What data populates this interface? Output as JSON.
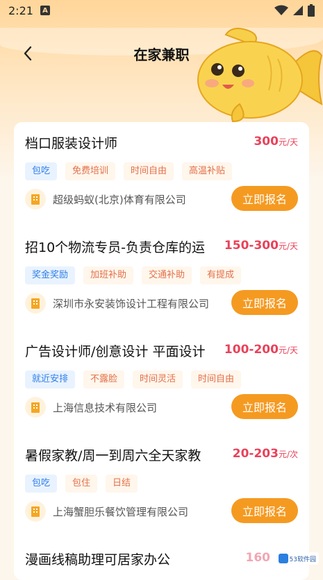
{
  "status_bar": {
    "time": "2:21",
    "indicator": "A"
  },
  "header": {
    "title": "在家兼职"
  },
  "jobs": [
    {
      "title": "档口服装设计师",
      "salary": "300",
      "unit": "元/天",
      "tags": [
        {
          "label": "包吃",
          "style": "blue"
        },
        {
          "label": "免费培训",
          "style": "orange"
        },
        {
          "label": "时间自由",
          "style": "orange"
        },
        {
          "label": "高温补贴",
          "style": "orange"
        }
      ],
      "company": "超级蚂蚁(北京)体育有限公司",
      "apply": "立即报名"
    },
    {
      "title": "招10个物流专员-负责仓库的运",
      "salary": "150-300",
      "unit": "元/天",
      "tags": [
        {
          "label": "奖金奖励",
          "style": "blue"
        },
        {
          "label": "加班补助",
          "style": "orange"
        },
        {
          "label": "交通补助",
          "style": "orange"
        },
        {
          "label": "有提成",
          "style": "orange"
        }
      ],
      "company": "深圳市永安装饰设计工程有限公司",
      "apply": "立即报名"
    },
    {
      "title": "广告设计师/创意设计 平面设计",
      "salary": "100-200",
      "unit": "元/天",
      "tags": [
        {
          "label": "就近安排",
          "style": "blue"
        },
        {
          "label": "不露脸",
          "style": "orange"
        },
        {
          "label": "时间灵活",
          "style": "orange"
        },
        {
          "label": "时间自由",
          "style": "orange"
        }
      ],
      "company": "上海信息技术有限公司",
      "apply": "立即报名"
    },
    {
      "title": "暑假家教/周一到周六全天家教",
      "salary": "20-203",
      "unit": "元/次",
      "tags": [
        {
          "label": "包吃",
          "style": "blue"
        },
        {
          "label": "包住",
          "style": "orange"
        },
        {
          "label": "日结",
          "style": "orange"
        }
      ],
      "company": "上海蟹胆乐餐饮管理有限公司",
      "apply": "立即报名"
    }
  ],
  "partial_job": {
    "title": "漫画线稿助理可居家办公",
    "salary": "160"
  },
  "watermark": "53软件园",
  "colors": {
    "accent": "#f59a21",
    "salary": "#e8425a",
    "tag_blue_bg": "#e9f3ff",
    "tag_blue_text": "#2f7ee8",
    "tag_orange_bg": "#fff6ec",
    "tag_orange_text": "#e3704a"
  },
  "icons": {
    "back": "chevron-left-icon",
    "company": "building-icon",
    "wifi": "wifi-icon",
    "signal": "signal-icon",
    "battery": "battery-icon",
    "mascot": "goldfish-mascot"
  }
}
